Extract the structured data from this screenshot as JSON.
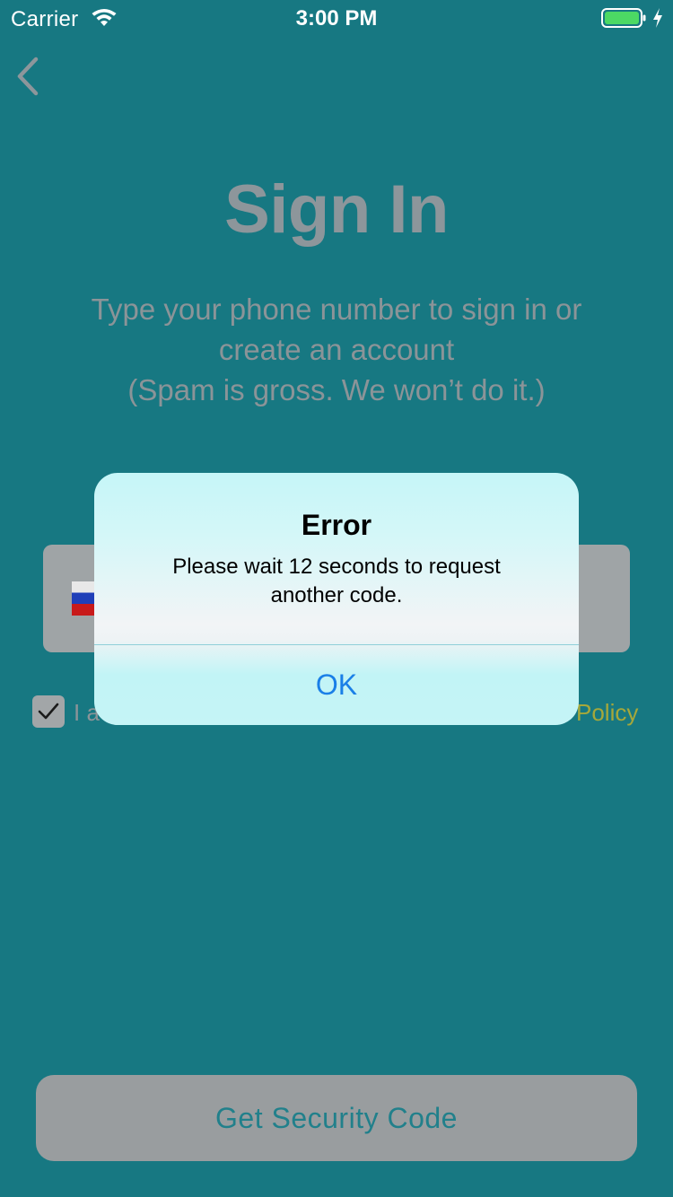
{
  "status_bar": {
    "carrier": "Carrier",
    "time": "3:00 PM",
    "icons": [
      "wifi-icon",
      "battery-icon",
      "charging-bolt-icon"
    ]
  },
  "nav": {
    "back_icon": "chevron-left-icon"
  },
  "page": {
    "title": "Sign In",
    "subtitle_lines": [
      "Type your phone number to sign in or",
      "create an account",
      "(Spam is gross. We won’t do it.)"
    ]
  },
  "phone_input": {
    "country_flag": "russia-flag-icon"
  },
  "terms": {
    "checked": true,
    "partial_text": "I a",
    "link_text_visible": "Policy"
  },
  "actions": {
    "get_code_label": "Get Security Code"
  },
  "alert": {
    "title": "Error",
    "message_lines": [
      "Please wait 12 seconds to request",
      "another code."
    ],
    "ok_label": "OK"
  },
  "colors": {
    "background": "#177882",
    "muted_text": "#8b9498",
    "link": "#a6a83a",
    "alert_button": "#1a7fe7",
    "battery": "#4cd964"
  }
}
